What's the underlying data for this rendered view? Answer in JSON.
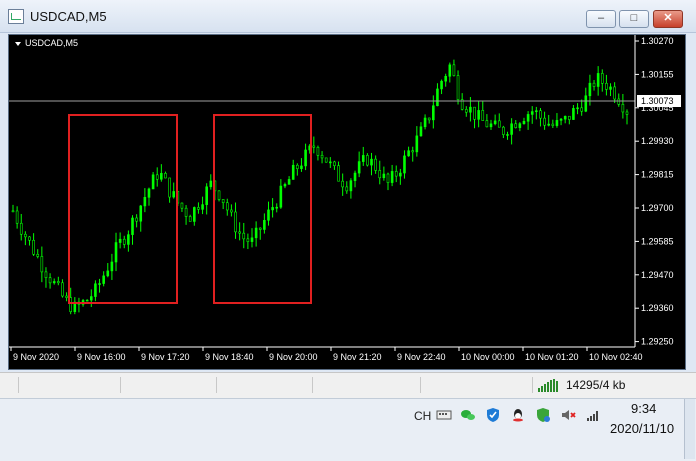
{
  "window": {
    "title": "USDCAD,M5",
    "buttons": [
      "minimize",
      "maximize",
      "close"
    ]
  },
  "chart": {
    "symbol_label": "USDCAD,M5",
    "price_ticks": [
      "1.30270",
      "1.30155",
      "1.30045",
      "1.29930",
      "1.29815",
      "1.29700",
      "1.29585",
      "1.29470",
      "1.29360",
      "1.29250"
    ],
    "current_price": "1.30073",
    "time_ticks": [
      "9 Nov 2020",
      "9 Nov 16:00",
      "9 Nov 17:20",
      "9 Nov 18:40",
      "9 Nov 20:00",
      "9 Nov 21:20",
      "9 Nov 22:40",
      "10 Nov 00:00",
      "10 Nov 01:20",
      "10 Nov 02:40"
    ],
    "colors": {
      "background": "#000000",
      "candles": "#00ff00",
      "text": "#ffffff",
      "price_line": "#c0c0c0",
      "highlight_boxes": "#ff2020"
    }
  },
  "chart_data": {
    "type": "candlestick",
    "title": "USDCAD,M5",
    "ylim": [
      1.292,
      1.3035
    ],
    "current_price": 1.30073,
    "highlight_regions": [
      {
        "from": "9 Nov 15:35",
        "to": "9 Nov 17:20",
        "price_range": [
          1.2941,
          1.30045
        ]
      },
      {
        "from": "9 Nov 18:25",
        "to": "9 Nov 20:20",
        "price_range": [
          1.2941,
          1.30045
        ]
      }
    ],
    "close_path": [
      1.297,
      1.2962,
      1.2955,
      1.2948,
      1.2942,
      1.2936,
      1.2933,
      1.2936,
      1.294,
      1.2948,
      1.2956,
      1.2962,
      1.297,
      1.2978,
      1.2985,
      1.2978,
      1.2972,
      1.2968,
      1.2974,
      1.298,
      1.2976,
      1.2967,
      1.296,
      1.2958,
      1.2965,
      1.2972,
      1.2978,
      1.2985,
      1.299,
      1.2995,
      1.299,
      1.2984,
      1.298,
      1.2985,
      1.299,
      1.2986,
      1.298,
      1.2985,
      1.2992,
      1.2998,
      1.3006,
      1.3018,
      1.3025,
      1.3012,
      1.3008,
      1.3004,
      1.3002,
      1.3,
      1.3003,
      1.3006,
      1.3008,
      1.3004,
      1.3002,
      1.3004,
      1.3008,
      1.3012,
      1.302,
      1.3018,
      1.3014,
      1.3008
    ]
  },
  "status": {
    "traffic": "14295/4 kb"
  },
  "taskbar": {
    "ime": "CH",
    "time": "9:34",
    "date": "2020/11/10",
    "tray_icons": [
      "wechat-icon",
      "shield-icon",
      "qq-icon",
      "security-icon",
      "mute-icon",
      "signal-icon"
    ]
  }
}
